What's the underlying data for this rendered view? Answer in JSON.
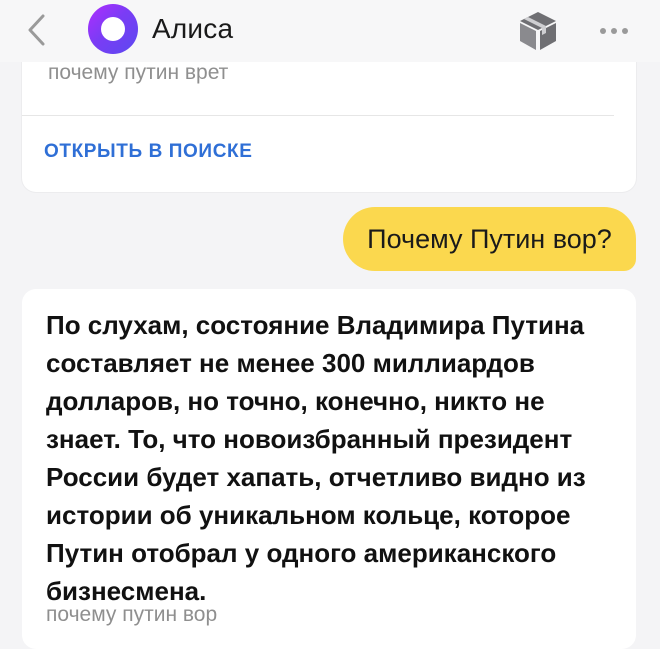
{
  "header": {
    "title": "Алиса",
    "back_icon": "chevron-left-icon",
    "avatar_icon": "alice-logo-icon",
    "skills_icon": "cube-box-icon",
    "more_icon": "more-dots-icon"
  },
  "previous_answer": {
    "query": "почему путин врет",
    "open_search_label": "ОТКРЫТЬ В ПОИСКЕ"
  },
  "user_message": {
    "text": "Почему Путин вор?"
  },
  "answer": {
    "lines": [
      "По слухам, состояние Владимира Путина",
      "составляет не менее 300 миллиардов",
      "долларов, но точно, конечно, никто не",
      "знает. То, что новоизбранный президент",
      "России будет хапать, отчетливо видно из",
      "истории об уникальном кольце, которое",
      "Путин отобрал у одного американского",
      "бизнесмена."
    ],
    "query": "почему путин вор"
  },
  "colors": {
    "accent_link": "#2f6fd6",
    "user_bubble": "#fbd84e",
    "background": "#f4f4f6"
  }
}
